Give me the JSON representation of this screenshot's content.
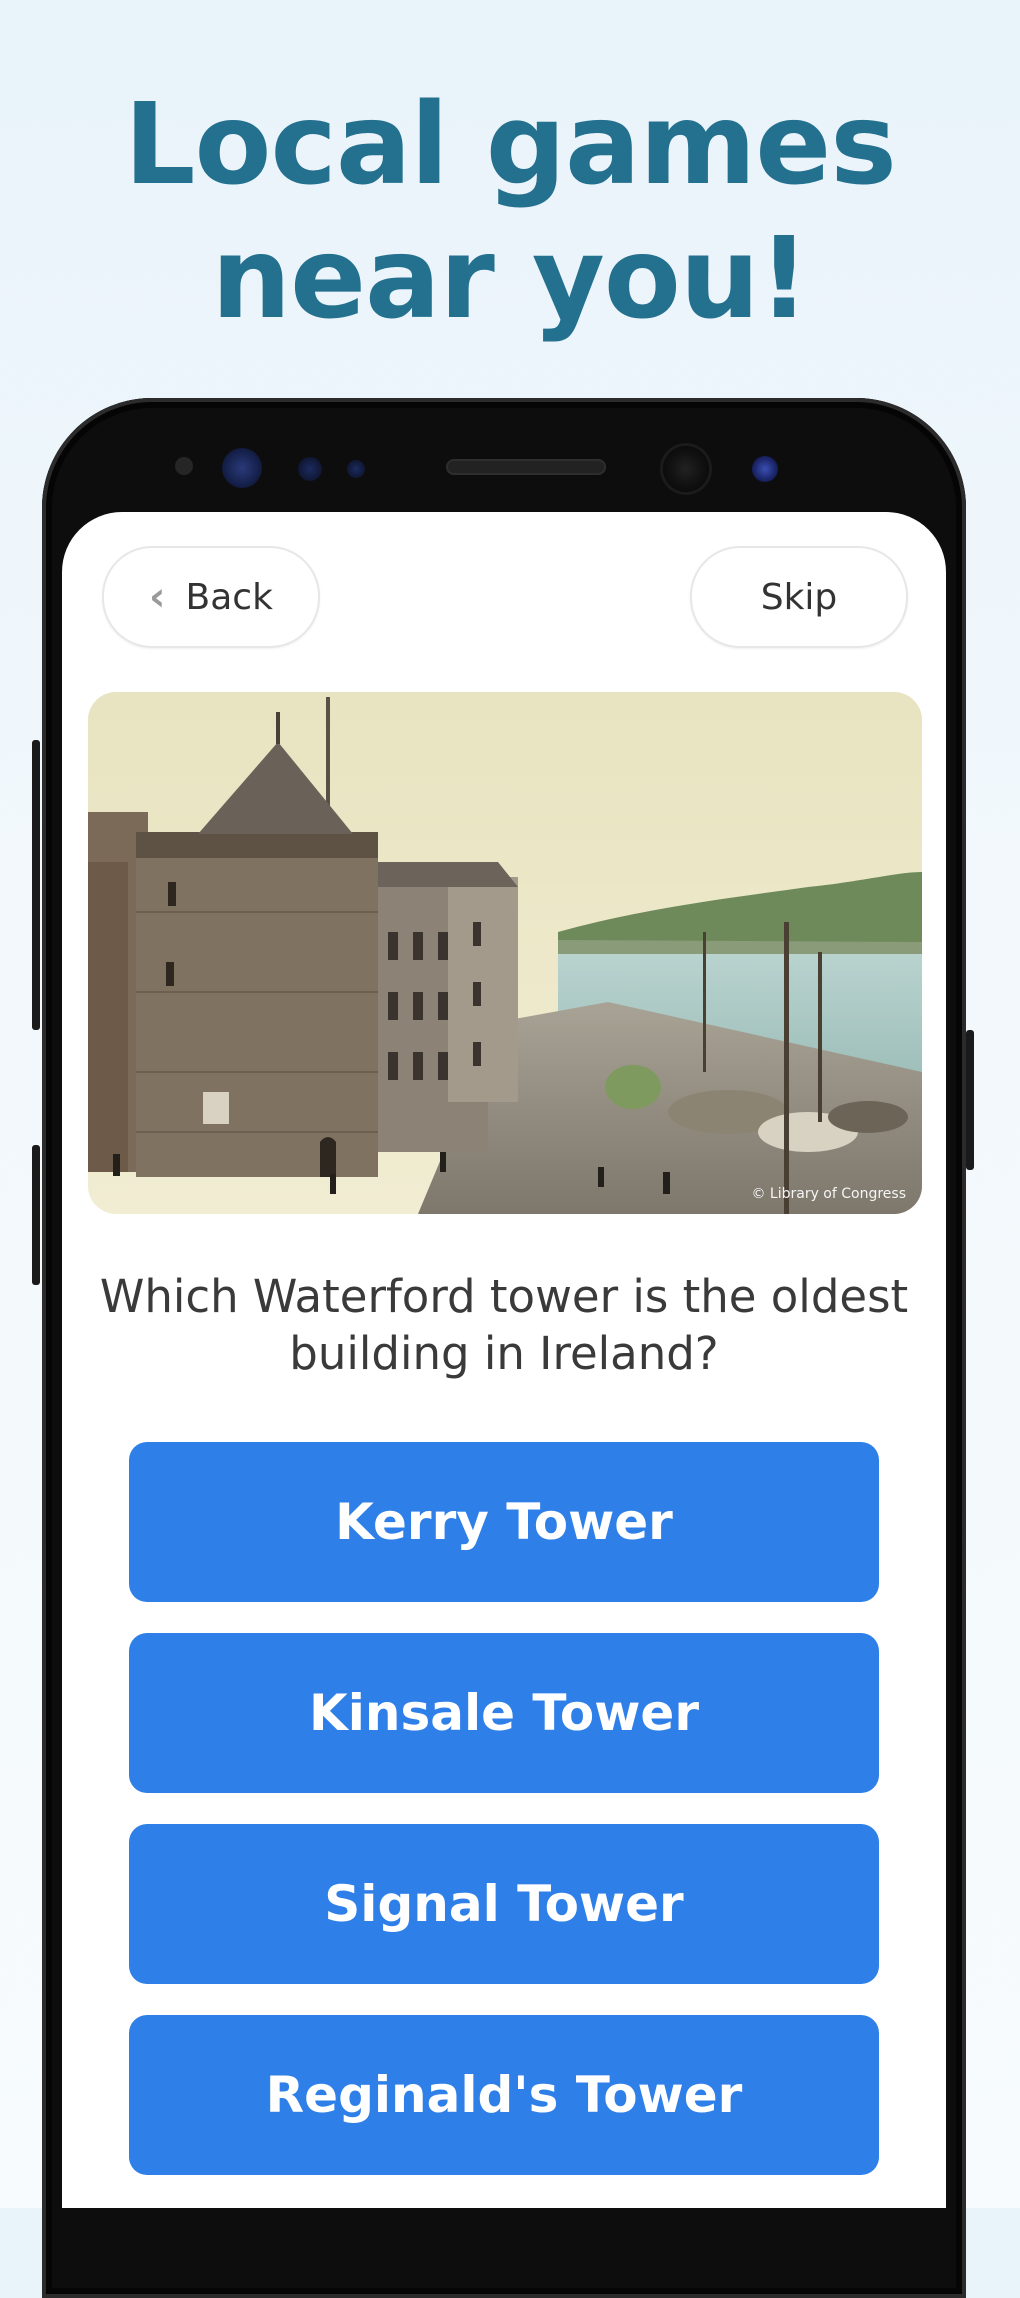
{
  "headline": {
    "line1": "Local games",
    "line2": "near you!"
  },
  "nav": {
    "back_label": "Back",
    "skip_label": "Skip"
  },
  "photo": {
    "credit": "© Library of Congress"
  },
  "question": "Which Waterford tower is the oldest building in Ireland?",
  "answers": [
    "Kerry Tower",
    "Kinsale Tower",
    "Signal Tower",
    "Reginald's Tower"
  ],
  "colors": {
    "headline": "#24708f",
    "answer_button": "#2f7fe8",
    "background": "#eaf4fa"
  }
}
